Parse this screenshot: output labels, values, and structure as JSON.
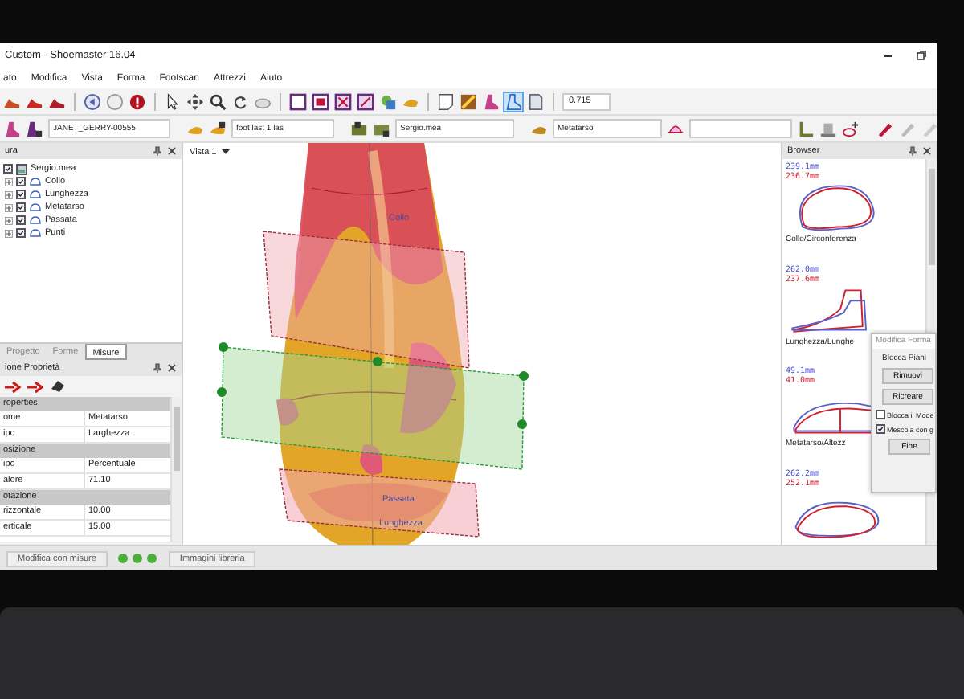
{
  "window": {
    "title": "Custom - Shoemaster 16.04"
  },
  "menu": [
    "ato",
    "Modifica",
    "Vista",
    "Forma",
    "Footscan",
    "Attrezzi",
    "Aiuto"
  ],
  "toolbar": {
    "zoom_value": "0.715"
  },
  "selectors": [
    {
      "value": "JANET_GERRY-00555"
    },
    {
      "value": "foot last 1.las"
    },
    {
      "value": "Sergio.mea"
    },
    {
      "value": "Metatarso"
    }
  ],
  "tree_panel": {
    "title": "ura",
    "items": [
      {
        "label": "Sergio.mea",
        "checked": true,
        "children": [
          {
            "label": "Collo",
            "checked": true
          },
          {
            "label": "Lunghezza",
            "checked": true
          },
          {
            "label": "Metatarso",
            "checked": true
          },
          {
            "label": "Passata",
            "checked": true
          },
          {
            "label": "Punti",
            "checked": true
          }
        ]
      }
    ]
  },
  "panel_tabs": [
    {
      "label": "Progetto",
      "selected": false
    },
    {
      "label": "Forme",
      "selected": false
    },
    {
      "label": "Misure",
      "selected": true
    }
  ],
  "properties_panel": {
    "title": "ione Proprietà",
    "rows": [
      {
        "kind": "group",
        "label": "roperties"
      },
      {
        "kind": "row",
        "label": "ome",
        "value": "Metatarso"
      },
      {
        "kind": "row",
        "label": "ipo",
        "value": "Larghezza"
      },
      {
        "kind": "group",
        "label": "osizione"
      },
      {
        "kind": "row",
        "label": "ipo",
        "value": "Percentuale"
      },
      {
        "kind": "row",
        "label": "alore",
        "value": "71.10"
      },
      {
        "kind": "group",
        "label": "otazione"
      },
      {
        "kind": "row",
        "label": "rizzontale",
        "value": "10.00"
      },
      {
        "kind": "row",
        "label": "erticale",
        "value": "15.00"
      }
    ]
  },
  "viewport": {
    "view_selector": "Vista 1",
    "labels": [
      {
        "text": "Collo"
      },
      {
        "text": "Passata"
      },
      {
        "text": "Lunghezza"
      }
    ]
  },
  "browser": {
    "title": "Browser",
    "items": [
      {
        "blue": "239.1mm",
        "red": "236.7mm",
        "caption": "Collo/Circonferenza"
      },
      {
        "blue": "262.0mm",
        "red": "237.6mm",
        "caption": "Lunghezza/Lunghe"
      },
      {
        "blue": "49.1mm",
        "red": "41.0mm",
        "caption": "Metatarso/Altezz"
      },
      {
        "blue": "262.2mm",
        "red": "252.1mm"
      }
    ]
  },
  "dialog": {
    "title": "Modifica Forma",
    "group": "Blocca Piani",
    "buttons": [
      "Rimuovi",
      "Ricreare"
    ],
    "options": [
      {
        "label": "Blocca il Mode",
        "checked": false
      },
      {
        "label": "Mescola con g",
        "checked": true
      }
    ],
    "confirm": "Fine"
  },
  "status_bar": {
    "tabs": [
      "Modifica con misure",
      "Immagini libreria"
    ]
  }
}
